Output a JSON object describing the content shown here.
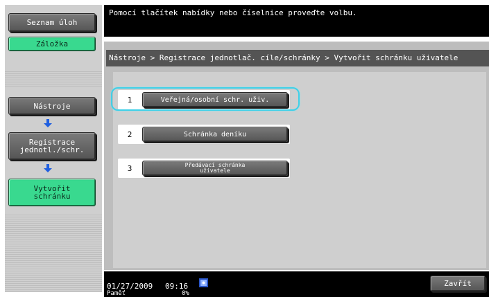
{
  "sidebar": {
    "task_list_label": "Seznam úloh",
    "bookmark_label": "Záložka",
    "steps": [
      {
        "label": "Nástroje"
      },
      {
        "label": "Registrace\njednotl./schr."
      },
      {
        "label": "Vytvořit\nschránku"
      }
    ]
  },
  "header": {
    "message": "Pomocí tlačítek nabídky nebo číselnice proveďte volbu."
  },
  "breadcrumb": "Nástroje > Registrace jednotlač. cíle/schránky > Vytvořit schránku uživatele",
  "options": [
    {
      "number": "1",
      "label": "Veřejná/osobní schr. uživ."
    },
    {
      "number": "2",
      "label": "Schránka deníku"
    },
    {
      "number": "3",
      "label_line1": "Předávací schránka",
      "label_line2": "uživatele"
    }
  ],
  "status": {
    "date": "01/27/2009",
    "time": "09:16",
    "memory_label": "Paměť",
    "memory_value": "0%"
  },
  "close_label": "Zavřít",
  "colors": {
    "highlight": "#3ed0e8",
    "active_step": "#39d98f"
  },
  "icons": {
    "step_arrow": "down-arrow-icon",
    "status": "network-status-icon"
  }
}
